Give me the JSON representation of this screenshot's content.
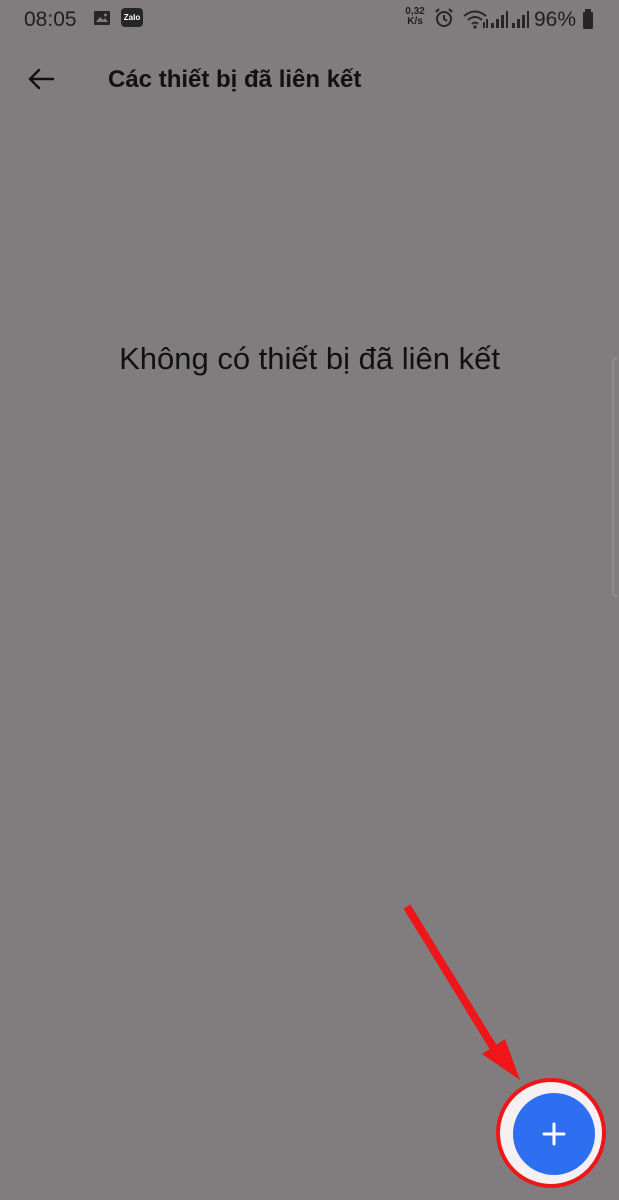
{
  "status_bar": {
    "time": "08:05",
    "zalo_label": "Zalo",
    "network_speed": {
      "value": "0,32",
      "unit": "K/s"
    },
    "battery": "96%",
    "icons": {
      "gallery": "gallery-icon",
      "zalo": "zalo-icon",
      "alarm": "alarm-icon",
      "wifi": "wifi-icon",
      "signal": "signal-icon",
      "battery": "battery-icon"
    }
  },
  "header": {
    "back_icon": "back-arrow-icon",
    "title": "Các thiết bị đã liên kết"
  },
  "content": {
    "empty_message": "Không có thiết bị đã liên kết"
  },
  "fab": {
    "icon": "plus-icon"
  },
  "colors": {
    "background": "#817d7e",
    "fab": "#2e6ef0",
    "annotation": "#ef1518"
  }
}
